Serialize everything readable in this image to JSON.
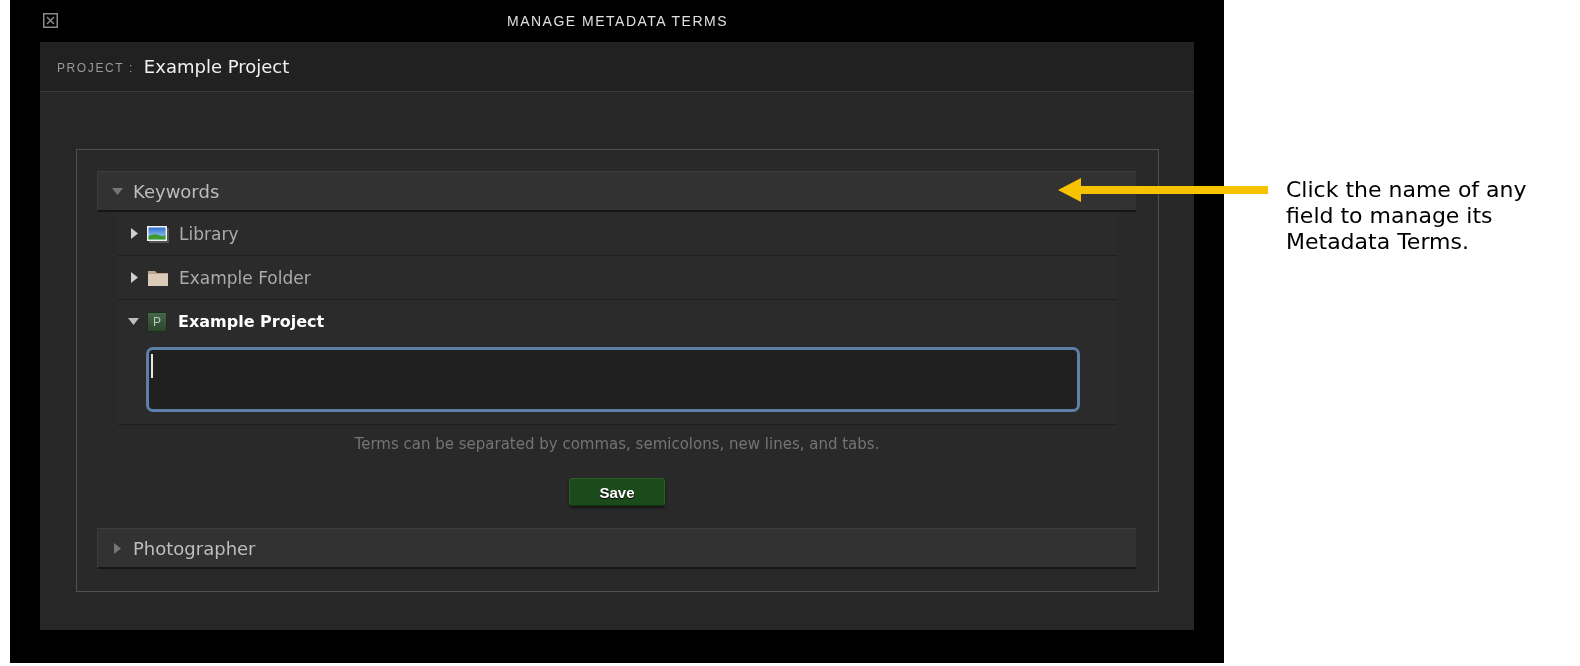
{
  "window": {
    "title": "MANAGE METADATA TERMS"
  },
  "project": {
    "label": "PROJECT :",
    "name": "Example Project"
  },
  "fields": [
    {
      "name": "Keywords",
      "expanded": true,
      "children": [
        {
          "name": "Library",
          "kind": "library",
          "expanded": false,
          "selected": false
        },
        {
          "name": "Example Folder",
          "kind": "folder",
          "expanded": false,
          "selected": false
        },
        {
          "name": "Example Project",
          "kind": "project",
          "icon_letter": "P",
          "expanded": true,
          "selected": true,
          "terms_field": {
            "focused": true
          }
        }
      ],
      "hint": "Terms can be separated by commas, semicolons, new lines, and tabs.",
      "save_button": "Save"
    },
    {
      "name": "Photographer",
      "expanded": false
    }
  ],
  "annotation": {
    "text": "Click the name of any field to manage its Metadata Terms."
  }
}
